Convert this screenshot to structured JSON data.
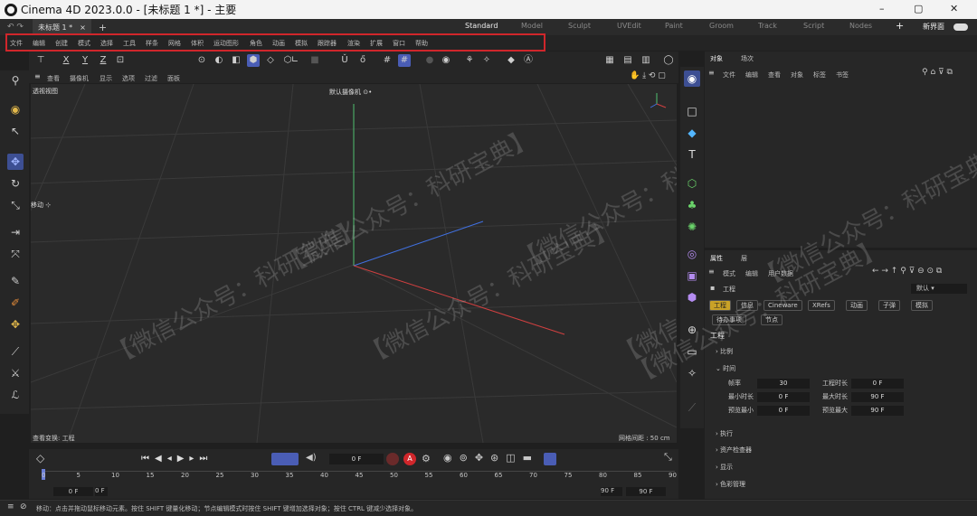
{
  "window": {
    "app": "Cinema 4D 2023.0.0",
    "title": "Cinema 4D 2023.0.0 - [未标题 1 *] - 主要",
    "controls": [
      "–",
      "▢",
      "✕"
    ]
  },
  "doc_tab": {
    "label": "未标题 1 *",
    "close": "×",
    "add": "+"
  },
  "layouts": [
    "Standard",
    "Model",
    "Sculpt",
    "UVEdit",
    "Paint",
    "Groom",
    "Track",
    "Script",
    "Nodes"
  ],
  "layout_add": "+",
  "new_interface": "新界面",
  "menu": [
    "文件",
    "编辑",
    "创建",
    "模式",
    "选择",
    "工具",
    "样条",
    "网格",
    "体积",
    "运动图形",
    "角色",
    "动画",
    "模拟",
    "跟踪器",
    "渲染",
    "扩展",
    "窗口",
    "帮助"
  ],
  "axes": [
    "X",
    "Y",
    "Z"
  ],
  "viewport": {
    "menu": [
      "查看",
      "摄像机",
      "显示",
      "选项",
      "过滤",
      "面板"
    ],
    "name": "透视视图",
    "camera": "默认摄像机 ⊙•",
    "tool_label": "移动 ⊹",
    "footer_left": "查看变换: 工程",
    "footer_right": "网格间距 : 50 cm"
  },
  "timeline": {
    "frame_field": "0 F",
    "ticks": [
      "0",
      "5",
      "10",
      "15",
      "20",
      "25",
      "30",
      "35",
      "40",
      "45",
      "50",
      "55",
      "60",
      "65",
      "70",
      "75",
      "80",
      "85",
      "90"
    ],
    "start": "0 F",
    "start2": "0 F",
    "end": "90 F",
    "end2": "90 F"
  },
  "status": "移动：点击并拖动鼠标移动元素。按住 SHIFT 键量化移动；节点编辑模式时按住 SHIFT 键增加选择对象；按住 CTRL 键减少选择对象。",
  "objects_panel": {
    "tabs": [
      "对象",
      "场次"
    ],
    "menu": [
      "文件",
      "编辑",
      "查看",
      "对象",
      "标签",
      "书签"
    ]
  },
  "attributes_panel": {
    "tabs": [
      "属性",
      "层"
    ],
    "menu": [
      "模式",
      "编辑",
      "用户数据"
    ],
    "object": "工程",
    "preset": "默认",
    "subtabs": [
      "工程",
      "信息",
      "Cineware",
      "XRefs",
      "动画",
      "子弹",
      "模拟",
      "待办事项",
      "节点"
    ],
    "heading": "工程",
    "sections": [
      "比例",
      "时间",
      "执行",
      "资产检查器",
      "显示",
      "色彩管理"
    ],
    "fields": [
      {
        "label": "帧率",
        "value": "30",
        "label2": "工程时长",
        "value2": "0 F"
      },
      {
        "label": "最小时长",
        "value": "0 F",
        "label2": "最大时长",
        "value2": "90 F"
      },
      {
        "label": "预览最小",
        "value": "0 F",
        "label2": "预览最大",
        "value2": "90 F"
      }
    ]
  },
  "watermark": "【微信公众号：科研宝典】",
  "colors": {
    "selection": "#4a5db5",
    "highlight": "#d0262b",
    "axis_x": "#d04040",
    "axis_y": "#50c070",
    "axis_z": "#4070e0"
  }
}
